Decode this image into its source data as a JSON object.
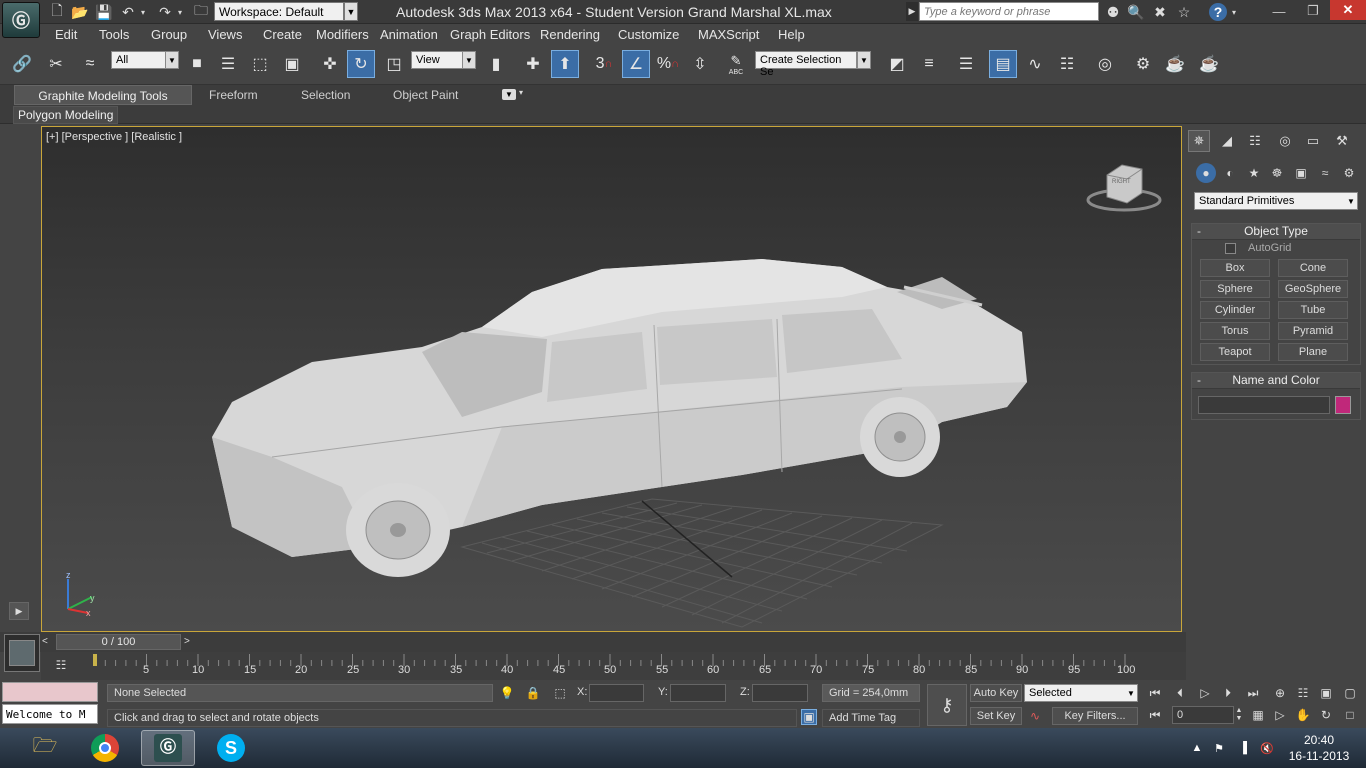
{
  "titlebar": {
    "workspace": "Workspace: Default",
    "title": "Autodesk 3ds Max  2013 x64  - Student Version    Grand Marshal XL.max",
    "search_placeholder": "Type a keyword or phrase"
  },
  "menu": [
    "Edit",
    "Tools",
    "Group",
    "Views",
    "Create",
    "Modifiers",
    "Animation",
    "Graph Editors",
    "Rendering",
    "Customize",
    "MAXScript",
    "Help"
  ],
  "toolbar": {
    "selection_filter": "All",
    "reference_coord": "View",
    "named_selection": "Create Selection Se",
    "snap_3": "3",
    "percent_snap": "%",
    "abc": "ABC"
  },
  "ribbon": {
    "tabs": [
      "Graphite Modeling Tools",
      "Freeform",
      "Selection",
      "Object Paint"
    ],
    "subtab": "Polygon Modeling"
  },
  "viewport": {
    "label": "[+] [Perspective ] [Realistic ]",
    "axis_z": "z",
    "axis_x": "x",
    "axis_y": "y",
    "viewcube_text": "RIGHT"
  },
  "command_panel": {
    "dropdown": "Standard Primitives",
    "object_type_title": "Object Type",
    "autogrid": "AutoGrid",
    "primitives": [
      "Box",
      "Cone",
      "Sphere",
      "GeoSphere",
      "Cylinder",
      "Tube",
      "Torus",
      "Pyramid",
      "Teapot",
      "Plane"
    ],
    "name_color_title": "Name and Color",
    "name_value": "",
    "object_color": "#c0287a"
  },
  "timeline": {
    "slider": "0 / 100",
    "ticks": [
      "5",
      "10",
      "15",
      "20",
      "25",
      "30",
      "35",
      "40",
      "45",
      "50",
      "55",
      "60",
      "65",
      "70",
      "75",
      "80",
      "85",
      "90",
      "95",
      "100"
    ]
  },
  "maxscript": {
    "listener": "Welcome to M"
  },
  "status": {
    "selection": "None Selected",
    "prompt": "Click and drag to select and rotate objects",
    "x_label": "X:",
    "y_label": "Y:",
    "z_label": "Z:",
    "grid": "Grid = 254,0mm",
    "add_time_tag": "Add Time Tag",
    "auto_key": "Auto Key",
    "set_key": "Set Key",
    "key_mode": "Selected",
    "key_filters": "Key Filters...",
    "frame": "0"
  },
  "taskbar": {
    "time": "20:40",
    "date": "16-11-2013"
  }
}
